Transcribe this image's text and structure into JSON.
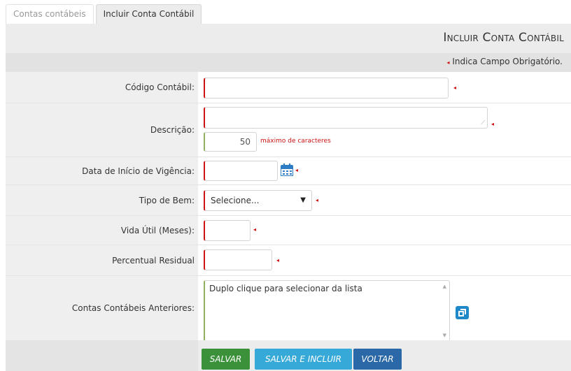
{
  "tabs": [
    {
      "label": "Contas contábeis",
      "active": false
    },
    {
      "label": "Incluir Conta Contábil",
      "active": true
    }
  ],
  "header": {
    "title": "Incluir Conta Contábil"
  },
  "required_note": "Indica Campo Obrigatório.",
  "required_marker": "◂",
  "form": {
    "codigo": {
      "label": "Código Contábil:",
      "value": ""
    },
    "descricao": {
      "label": "Descrição:",
      "value": "",
      "counter": "50",
      "counter_note": "máximo de caracteres"
    },
    "data_inicio": {
      "label": "Data de Início de Vigência:",
      "value": ""
    },
    "tipo_bem": {
      "label": "Tipo de Bem:",
      "value": "Selecione..."
    },
    "vida_util": {
      "label": "Vida Útil (Meses):",
      "value": ""
    },
    "percentual": {
      "label": "Percentual Residual",
      "value": ""
    },
    "contas_anteriores": {
      "label": "Contas Contábeis Anteriores:",
      "placeholder": "Duplo clique para selecionar da lista"
    }
  },
  "buttons": {
    "salvar": "SALVAR",
    "salvar_incluir": "SALVAR E INCLUIR",
    "voltar": "VOLTAR"
  },
  "colors": {
    "required": "#cc1111",
    "salvar": "#3a913a",
    "salvar_incluir": "#36a9d9",
    "voltar": "#2b68a8",
    "icon": "#1e88c8"
  },
  "icons": {
    "calendar": "calendar-icon",
    "copy": "copy-icon",
    "dropdown": "caret-down-icon"
  }
}
